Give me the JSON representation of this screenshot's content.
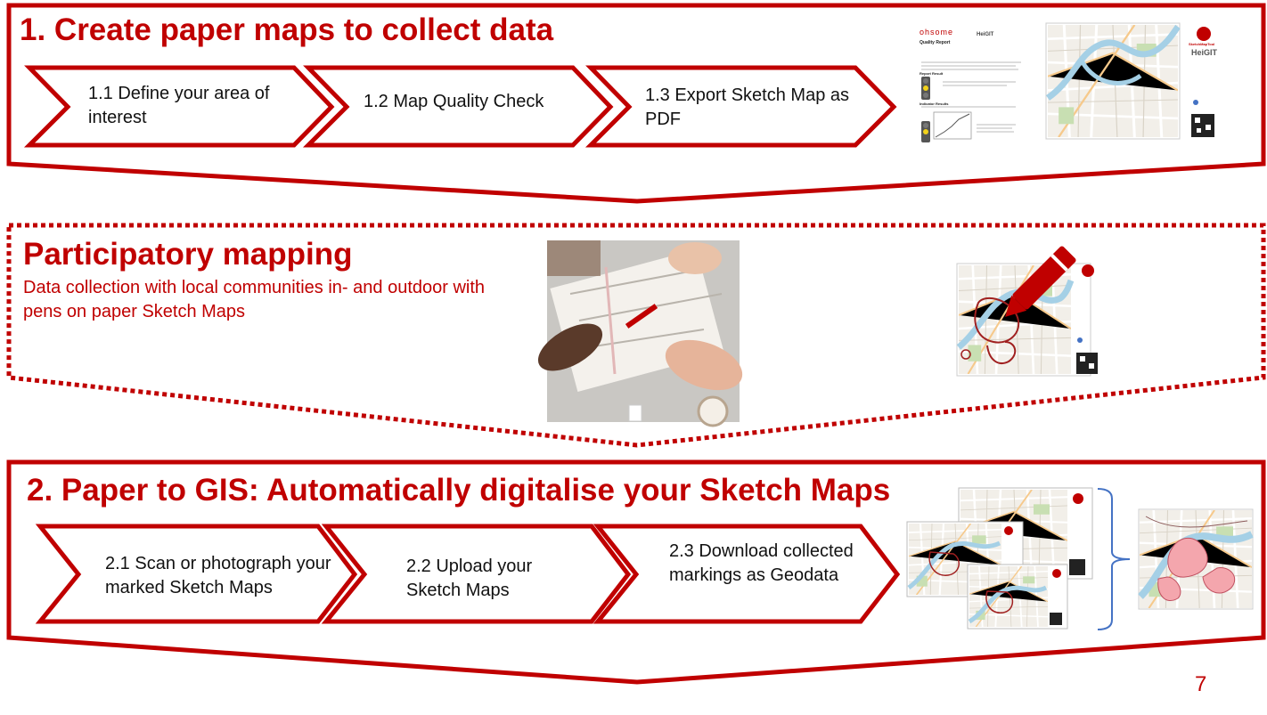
{
  "section1": {
    "title": "1. Create paper maps to collect data",
    "steps": [
      {
        "label": "1.1 Define your area of interest"
      },
      {
        "label": "1.2 Map Quality Check"
      },
      {
        "label": "1.3 Export Sketch Map as PDF"
      }
    ],
    "quality_report": {
      "brand": "ohsome",
      "heading": "Quality Report",
      "subheading": "Report Result",
      "section": "Indicator Results"
    },
    "logos": {
      "sketchmap": "SketchMapTool",
      "heigit": "HeiGIT"
    }
  },
  "section_participatory": {
    "title": "Participatory mapping",
    "subtitle": "Data collection with local communities in- and outdoor with pens on paper Sketch Maps"
  },
  "section2": {
    "title": "2. Paper to GIS: Automatically digitalise your Sketch Maps",
    "steps": [
      {
        "label": "2.1 Scan or photograph your marked Sketch Maps"
      },
      {
        "label": "2.2 Upload your Sketch Maps"
      },
      {
        "label": "2.3 Download collected markings as Geodata"
      }
    ]
  },
  "page_number": "7",
  "colors": {
    "accent": "#c00000",
    "bracket": "#4472c4",
    "map_bg": "#f2efe9",
    "river": "#a5d0e6",
    "green": "#c8dfb2"
  }
}
